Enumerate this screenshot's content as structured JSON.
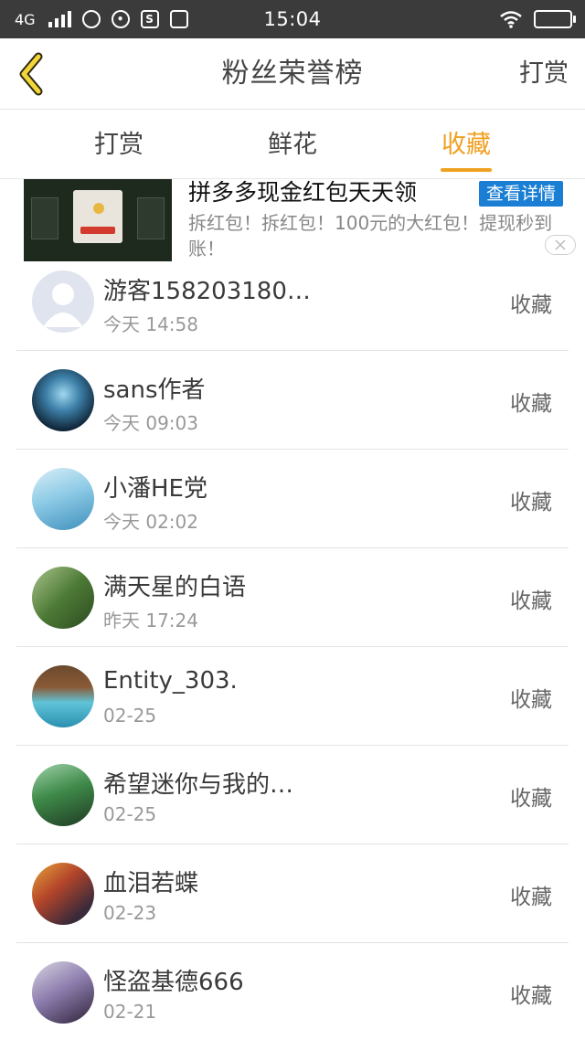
{
  "status_bar": {
    "network": "4G",
    "time": "15:04",
    "icons": [
      "signal-icon",
      "app-icon",
      "cat-icon",
      "s-icon",
      "bag-icon",
      "wifi-icon",
      "battery-icon"
    ]
  },
  "header": {
    "title": "粉丝荣誉榜",
    "right_action": "打赏",
    "back_icon": "chevron-left-icon"
  },
  "tabs": [
    {
      "label": "打赏",
      "active": false
    },
    {
      "label": "鲜花",
      "active": false
    },
    {
      "label": "收藏",
      "active": true
    }
  ],
  "ad": {
    "title": "拼多多现金红包天天领",
    "button": "查看详情",
    "description": "拆红包！拆红包！100元的大红包！提现秒到账！"
  },
  "list": [
    {
      "name": "游客158203180…",
      "time": "今天 14:58",
      "action": "收藏"
    },
    {
      "name": "sans作者",
      "time": "今天 09:03",
      "action": "收藏"
    },
    {
      "name": "小潘HE党",
      "time": "今天 02:02",
      "action": "收藏"
    },
    {
      "name": "满天星的白语",
      "time": "昨天 17:24",
      "action": "收藏"
    },
    {
      "name": "Entity_303.",
      "time": "02-25",
      "action": "收藏"
    },
    {
      "name": "希望迷你与我的…",
      "time": "02-25",
      "action": "收藏"
    },
    {
      "name": "血泪若蝶",
      "time": "02-23",
      "action": "收藏"
    },
    {
      "name": "怪盗基德666",
      "time": "02-21",
      "action": "收藏"
    }
  ],
  "colors": {
    "accent": "#f0a020",
    "status_bar": "#3b3b3b",
    "ad_button": "#1a7fd4"
  }
}
